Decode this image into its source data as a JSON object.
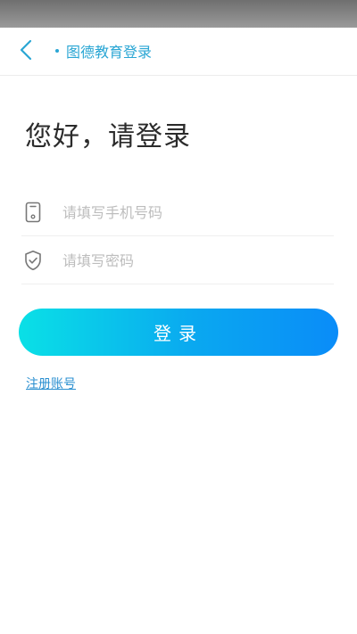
{
  "header": {
    "title": "图德教育登录",
    "back_icon": "chevron-left-icon",
    "accent_color": "#2aa6d4"
  },
  "main": {
    "greeting": "您好，请登录",
    "phone_field": {
      "value": "",
      "placeholder": "请填写手机号码",
      "icon": "phone-icon"
    },
    "password_field": {
      "value": "",
      "placeholder": "请填写密码",
      "icon": "shield-check-icon"
    },
    "login_label": "登录",
    "register_label": "注册账号"
  },
  "colors": {
    "button_gradient_start": "#0ae0e6",
    "button_gradient_end": "#0a8cf8",
    "link": "#2a8fd0"
  }
}
